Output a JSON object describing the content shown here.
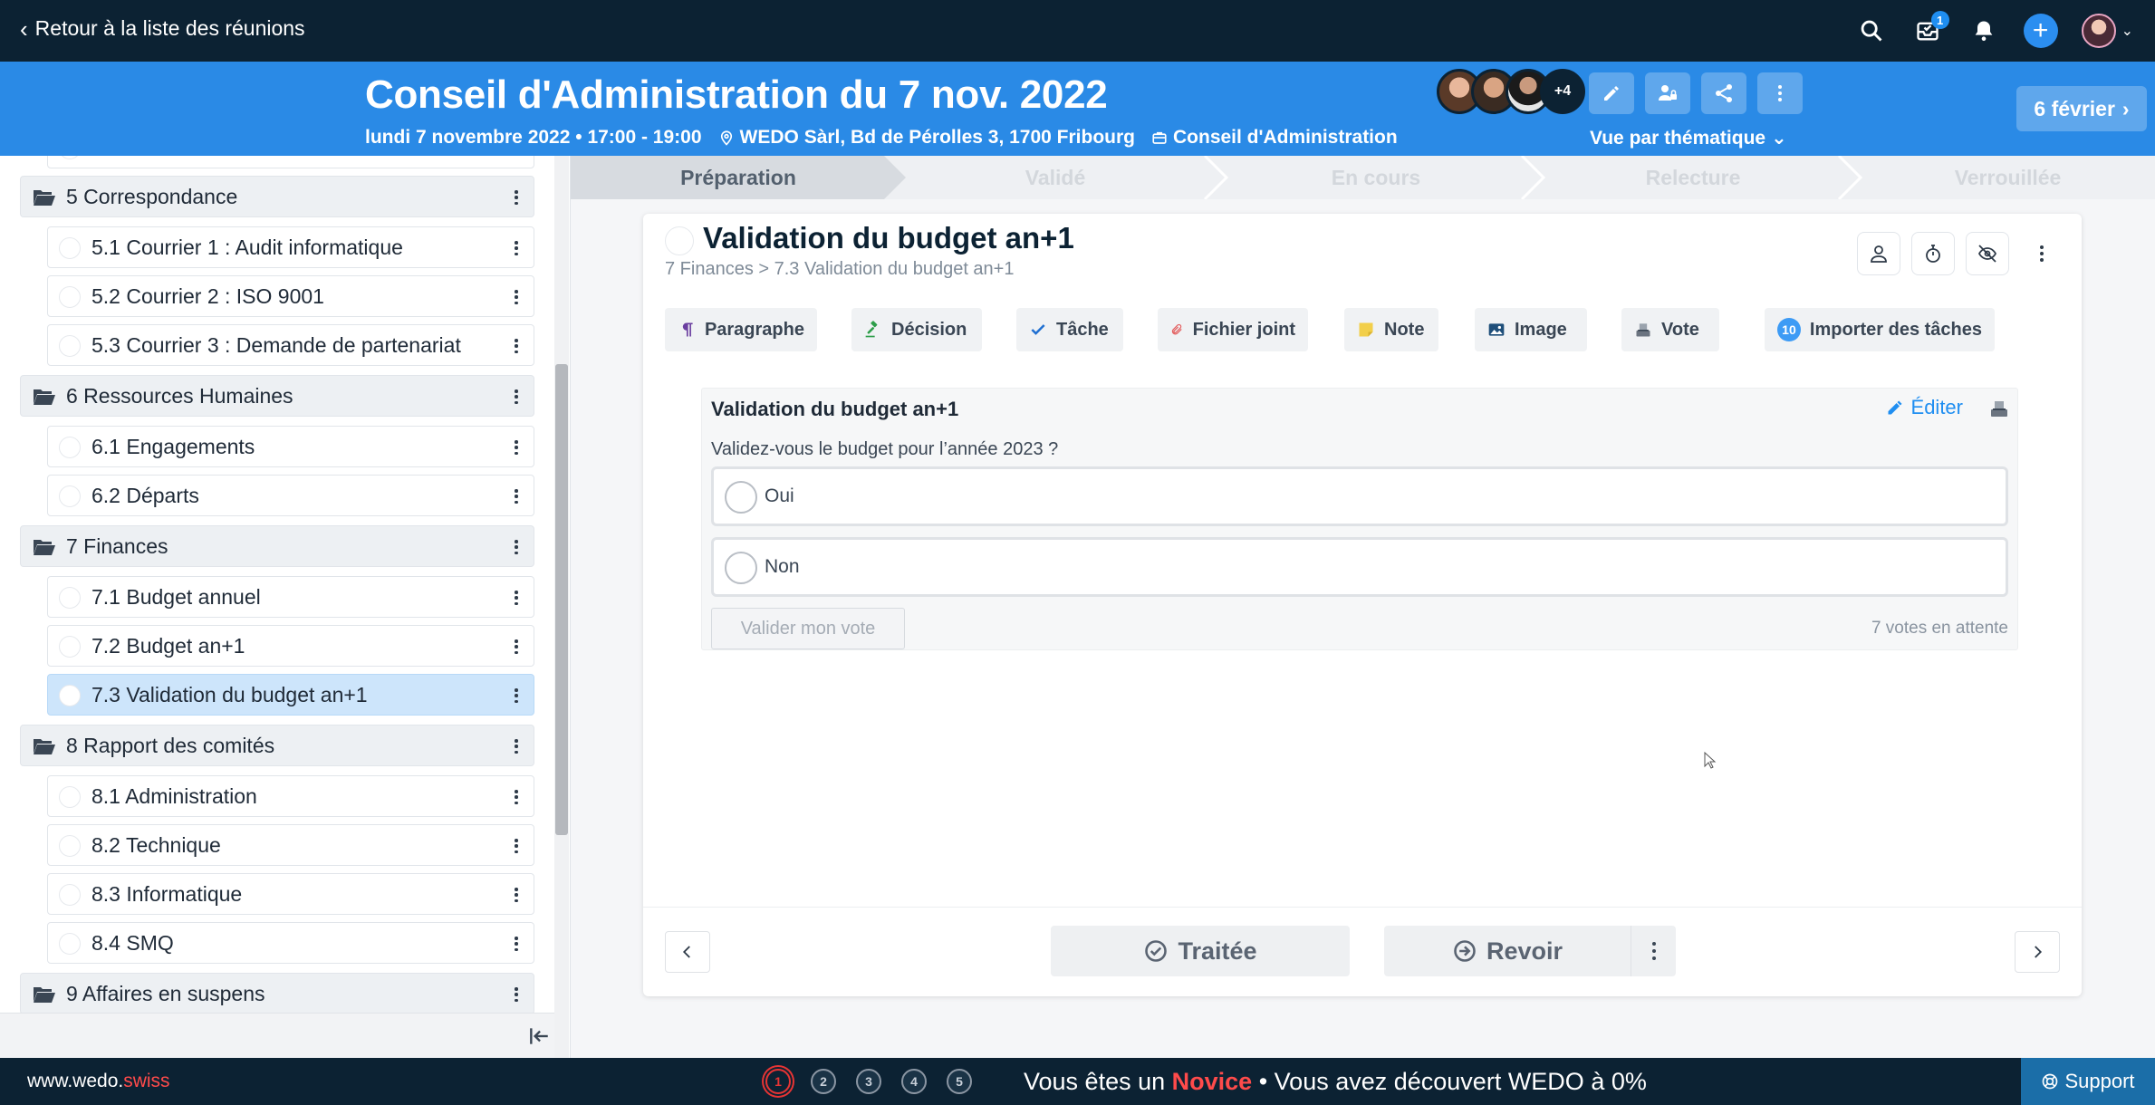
{
  "topnav": {
    "back_label": "Retour à la liste des réunions",
    "inbox_count": "1"
  },
  "meeting": {
    "title": "Conseil d'Administration du 7 nov. 2022",
    "datetime": "lundi 7 novembre 2022 • 17:00 - 19:00",
    "location": "WEDO Sàrl, Bd de Pérolles 3, 1700 Fribourg",
    "organ": "Conseil d'Administration",
    "participants_more": "+4",
    "view_mode": "Vue par thématique",
    "next_meeting": "6 février"
  },
  "sidebar": {
    "groups": [
      {
        "label": "5 Correspondance"
      },
      {
        "label": "6 Ressources Humaines"
      },
      {
        "label": "7 Finances"
      },
      {
        "label": "8 Rapport des comités"
      },
      {
        "label": "9 Affaires en suspens"
      }
    ],
    "items": [
      {
        "label": "5.1 Courrier 1 : Audit informatique"
      },
      {
        "label": "5.2 Courrier 2 : ISO 9001"
      },
      {
        "label": "5.3 Courrier 3 : Demande de partenariat"
      },
      {
        "label": "6.1 Engagements"
      },
      {
        "label": "6.2 Départs"
      },
      {
        "label": "7.1 Budget annuel"
      },
      {
        "label": "7.2 Budget an+1"
      },
      {
        "label": "7.3 Validation du budget an+1"
      },
      {
        "label": "8.1 Administration"
      },
      {
        "label": "8.2 Technique"
      },
      {
        "label": "8.3 Informatique"
      },
      {
        "label": "8.4 SMQ"
      }
    ],
    "active_item": "7.3 Validation du budget an+1"
  },
  "steps": [
    "Préparation",
    "Validé",
    "En cours",
    "Relecture",
    "Verrouillée"
  ],
  "current_step": "Préparation",
  "topic": {
    "title": "Validation du budget an+1",
    "breadcrumb": "7 Finances > 7.3 Validation du budget an+1",
    "add_buttons": {
      "paragraph": "Paragraphe",
      "decision": "Décision",
      "task": "Tâche",
      "attachment": "Fichier joint",
      "note": "Note",
      "image": "Image",
      "vote": "Vote",
      "import_tasks": "Importer des tâches",
      "import_count": "10"
    }
  },
  "vote": {
    "title": "Validation du budget an+1",
    "edit_label": "Éditer",
    "question": "Validez-vous le budget pour l’année 2023 ?",
    "options": [
      "Oui",
      "Non"
    ],
    "submit_label": "Valider mon vote",
    "pending": "7 votes en attente"
  },
  "footer": {
    "treated_label": "Traitée",
    "review_label": "Revoir"
  },
  "bottombar": {
    "site_prefix": "www.wedo.",
    "site_suffix": "swiss",
    "dots": [
      "1",
      "2",
      "3",
      "4",
      "5"
    ],
    "level_prefix": "Vous êtes un",
    "level": "Novice",
    "level_suffix": "• Vous avez découvert WEDO à 0%",
    "support_label": "Support"
  },
  "colors": {
    "nav_bg": "#0c2233",
    "header_bg": "#2a8ae6",
    "accent": "#1f8ef1",
    "active_item": "#cde5fb",
    "level_red": "#ff4b4b"
  }
}
